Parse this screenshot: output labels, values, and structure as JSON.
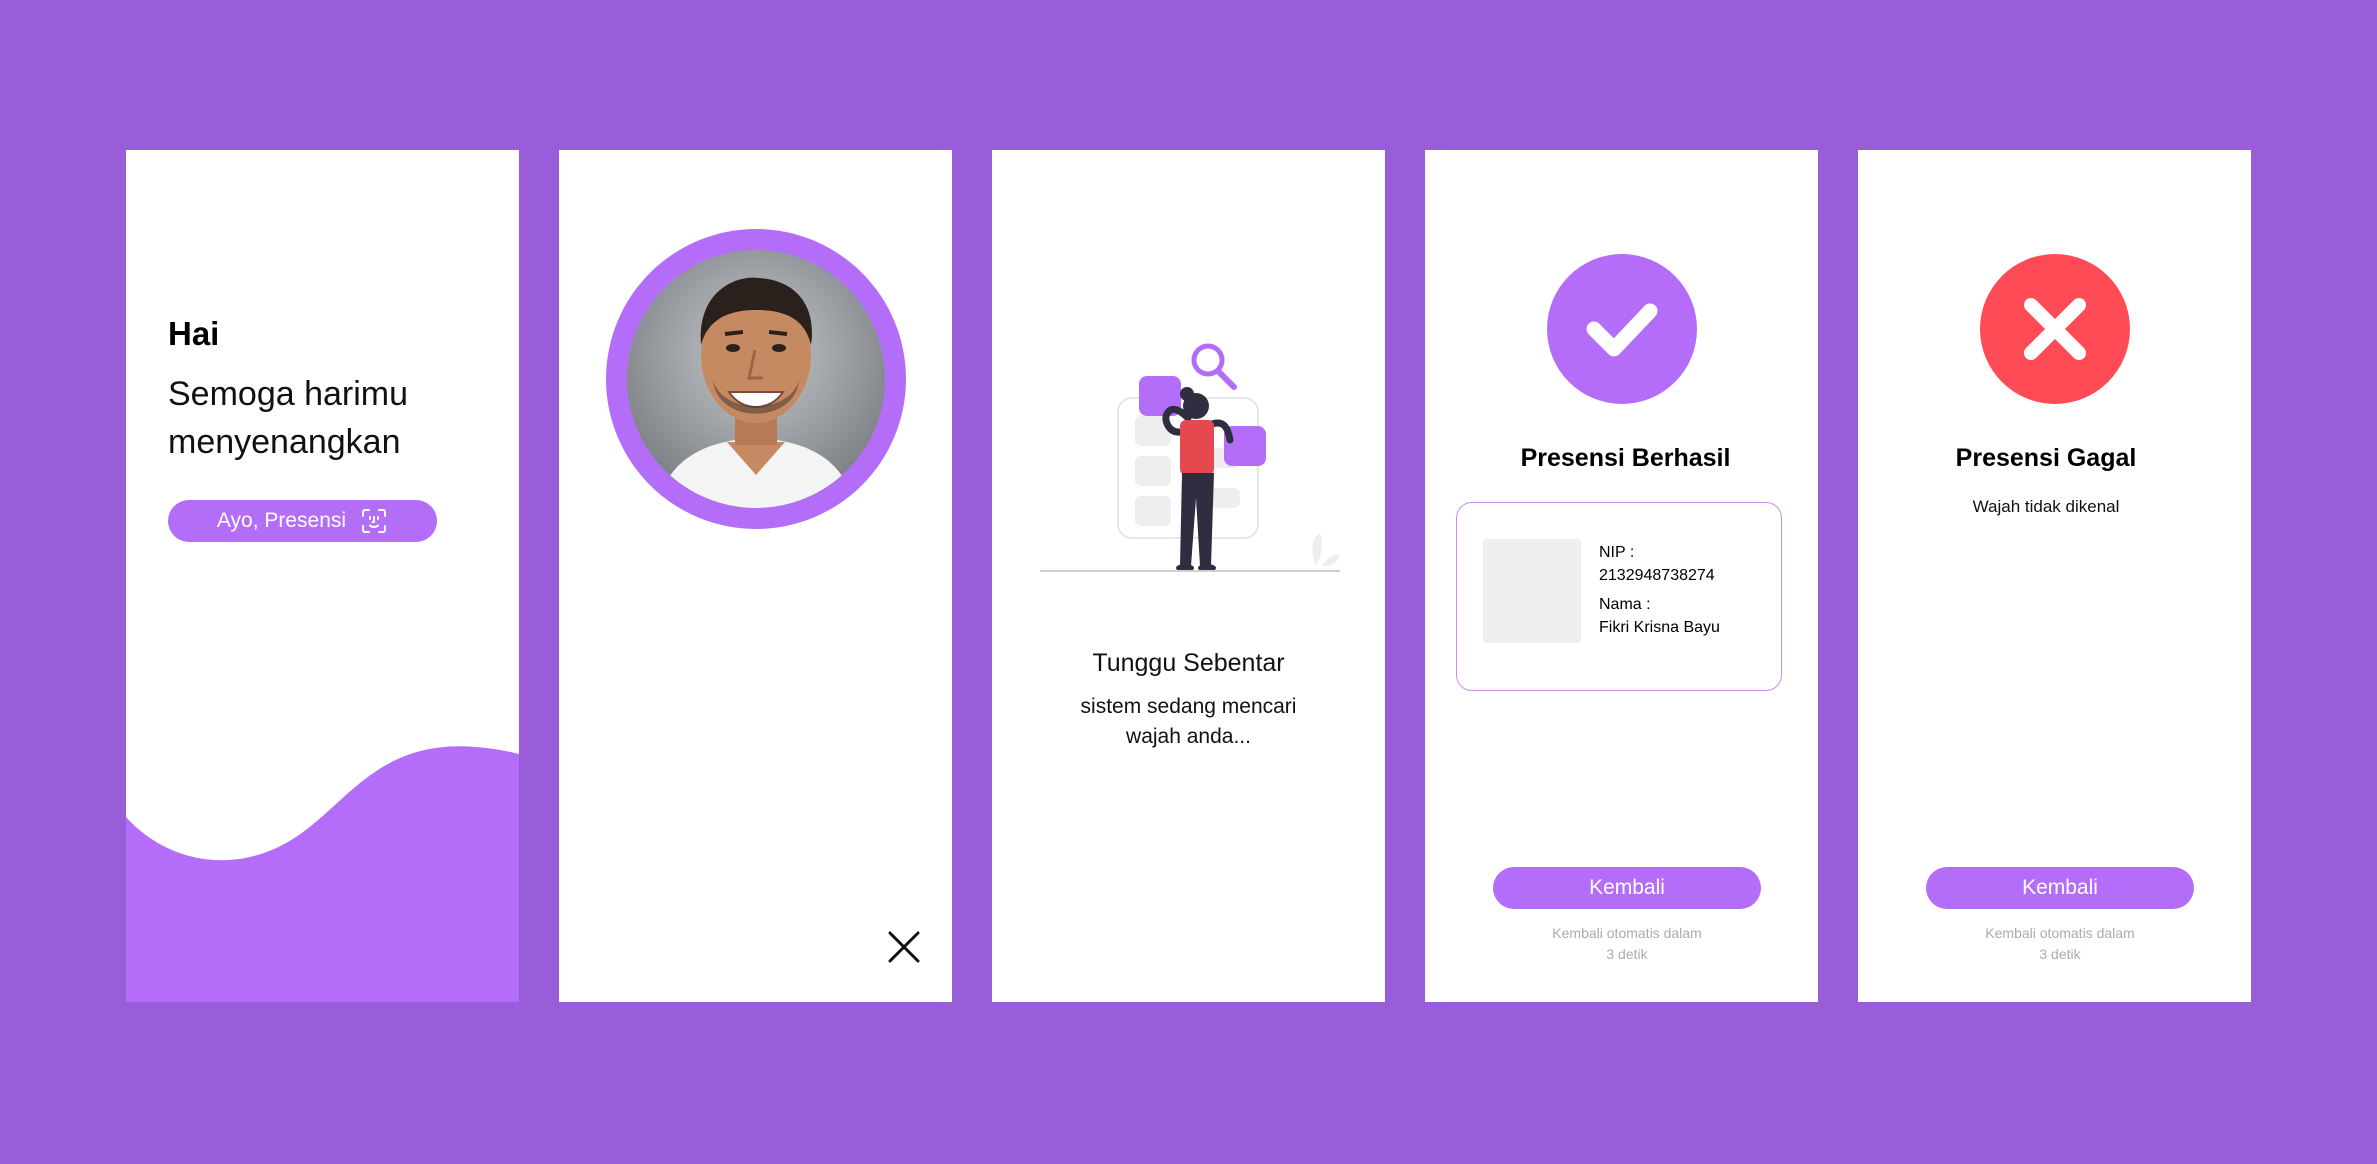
{
  "colors": {
    "background": "#995dd9",
    "accent": "#b46df9",
    "error": "#ff4b55",
    "screen": "#ffffff"
  },
  "screen_welcome": {
    "greeting": "Hai",
    "message_line1": "Semoga harimu",
    "message_line2": "menyenangkan",
    "button_label": "Ayo, Presensi",
    "button_icon": "face-scan-icon"
  },
  "screen_camera": {
    "photo": "face-photo",
    "close_icon": "close-icon"
  },
  "screen_loading": {
    "illustration": "person-search-illustration",
    "title": "Tunggu Sebentar",
    "desc_line1": "sistem sedang mencari",
    "desc_line2": "wajah anda..."
  },
  "screen_success": {
    "icon": "check-icon",
    "title": "Presensi Berhasil",
    "nip_label": "NIP :",
    "nip_value": "2132948738274",
    "name_label": "Nama :",
    "name_value": "Fikri Krisna Bayu",
    "button_label": "Kembali",
    "note_line1": "Kembali otomatis dalam",
    "note_line2": "3 detik"
  },
  "screen_failed": {
    "icon": "x-icon",
    "title": "Presensi Gagal",
    "message": "Wajah tidak dikenal",
    "button_label": "Kembali",
    "note_line1": "Kembali otomatis dalam",
    "note_line2": "3 detik"
  }
}
